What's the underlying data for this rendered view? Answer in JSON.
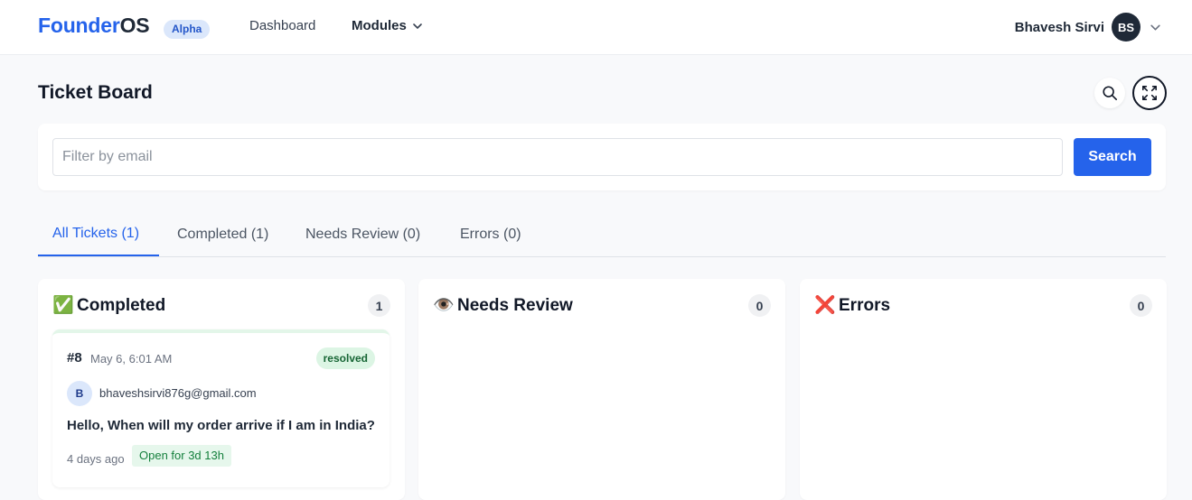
{
  "brand": {
    "accent": "Founder",
    "rest": "OS",
    "badge": "Alpha"
  },
  "nav": {
    "dashboard": "Dashboard",
    "modules": "Modules",
    "modules_icon": "chevron-down-icon"
  },
  "user": {
    "name": "Bhavesh Sirvi",
    "initials": "BS",
    "menu_icon": "chevron-down-icon"
  },
  "page": {
    "title": "Ticket Board",
    "search_icon": "search-icon",
    "expand_icon": "expand-icon"
  },
  "filter": {
    "placeholder": "Filter by email",
    "value": "",
    "button_label": "Search"
  },
  "tabs": [
    {
      "label": "All Tickets (1)",
      "active": true
    },
    {
      "label": "Completed (1)",
      "active": false
    },
    {
      "label": "Needs Review (0)",
      "active": false
    },
    {
      "label": "Errors (0)",
      "active": false
    }
  ],
  "columns": [
    {
      "emoji": "✅",
      "title": "Completed",
      "count": "1"
    },
    {
      "emoji": "👁️",
      "title": "Needs Review",
      "count": "0"
    },
    {
      "emoji": "❌",
      "title": "Errors",
      "count": "0"
    }
  ],
  "ticket": {
    "id": "#8",
    "date": "May 6, 6:01 AM",
    "status": "resolved",
    "avatar_initial": "B",
    "email": "bhaveshsirvi876g@gmail.com",
    "message": "Hello, When will my order arrive if I am in India?",
    "age": "4 days ago",
    "open_duration": "Open for 3d 13h"
  },
  "colors": {
    "accent": "#2563eb",
    "status_resolved_bg": "#dcf5e4",
    "status_resolved_text": "#166534"
  }
}
